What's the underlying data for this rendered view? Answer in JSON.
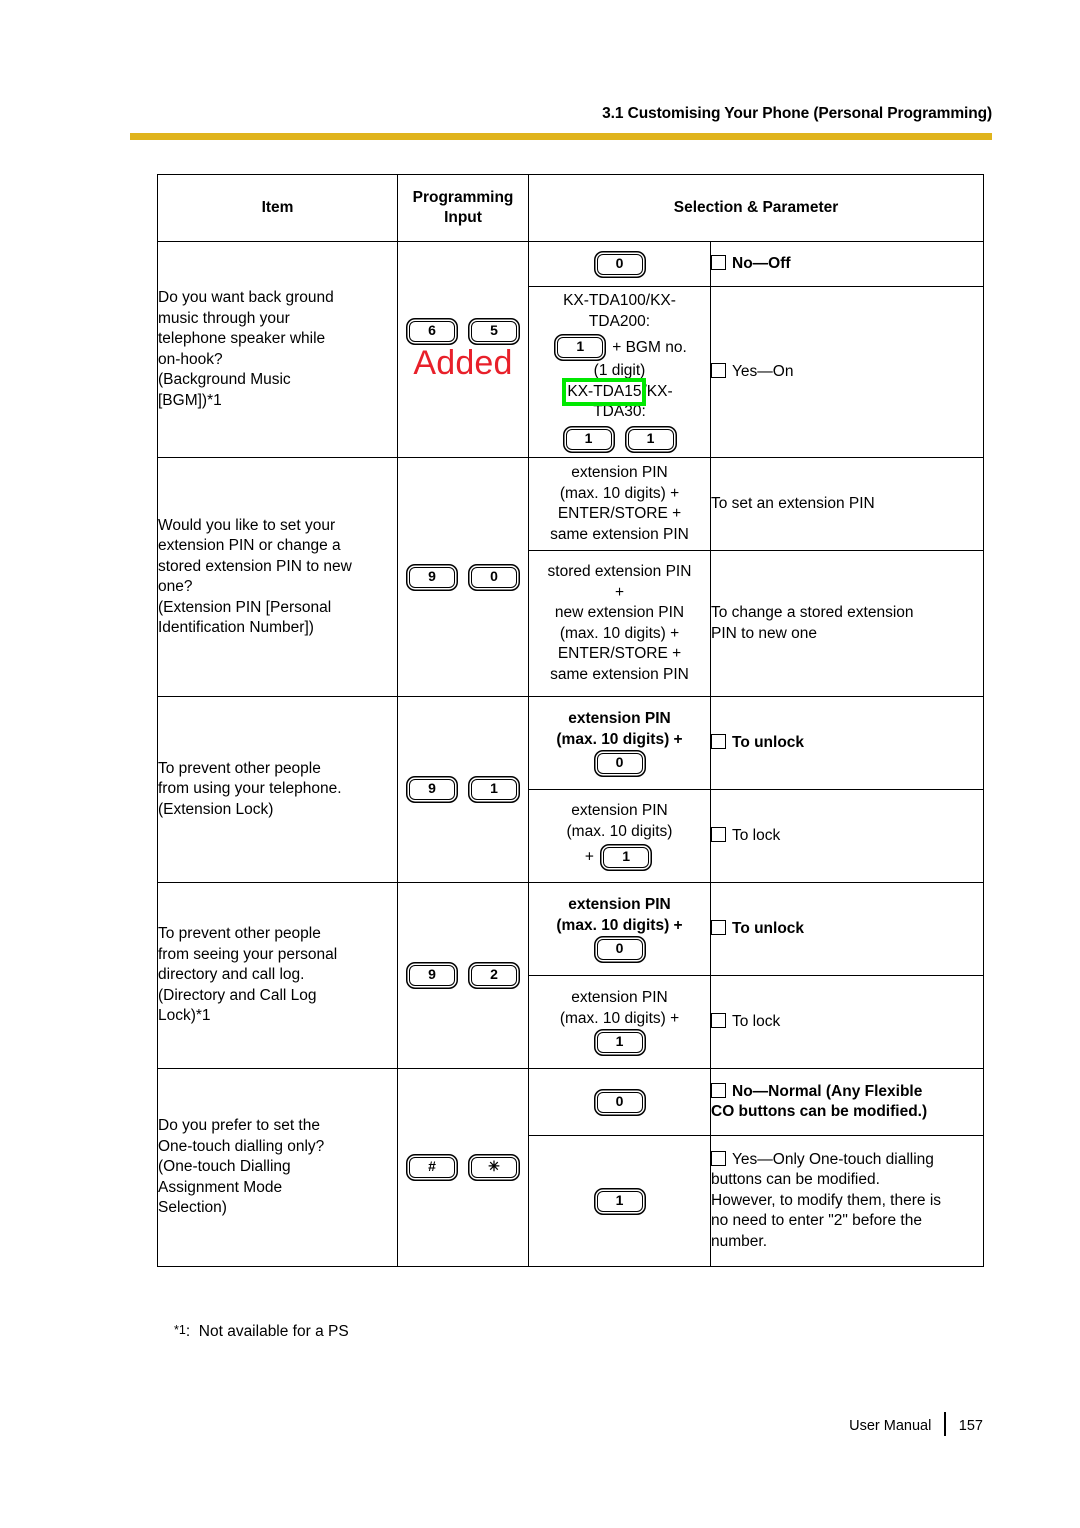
{
  "header": {
    "title": "3.1 Customising Your Phone (Personal Programming)",
    "rule_color": "#e0b41c"
  },
  "annotations": {
    "added_label": "Added",
    "added_color": "#e8202a",
    "highlight_color": "#00e800",
    "highlighted_text": "KX-TDA15"
  },
  "table": {
    "columns": [
      {
        "label": "Item"
      },
      {
        "label_line1": "Programming",
        "label_line2": "Input"
      },
      {
        "label": "Selection & Parameter"
      }
    ],
    "rows": [
      {
        "item": "Do you want back ground music through your telephone speaker while on-hook? (Background Music [BGM])*1",
        "item_lines": [
          "Do you want back ground",
          "music through your",
          "telephone speaker while",
          "on-hook?",
          "(Background Music",
          "[BGM])*1"
        ],
        "programming_input": [
          "6",
          "5"
        ],
        "options": [
          {
            "selection_lines": [],
            "selection_key": "0",
            "parameter": "No—Off",
            "parameter_bold": true
          },
          {
            "selection_lines": [
              "KX-TDA100/KX-",
              "TDA200:"
            ],
            "selection_key_inline": "1",
            "selection_inline_suffix": "+ BGM no.",
            "selection_sub": "(1 digit)",
            "selection_lines2_hl": "KX-TDA15",
            "selection_lines2_rest": "/KX-",
            "selection_lines3": "TDA30:",
            "selection_keys2": [
              "1",
              "1"
            ],
            "parameter": "Yes—On",
            "parameter_bold": false
          }
        ]
      },
      {
        "item_lines": [
          "Would you like to set your",
          "extension PIN or change a",
          "stored extension PIN to new",
          "one?",
          "(Extension PIN [Personal",
          "Identification Number])"
        ],
        "programming_input": [
          "9",
          "0"
        ],
        "options": [
          {
            "selection_text_lines": [
              "extension PIN",
              "(max. 10 digits) +",
              "ENTER/STORE +",
              "same extension PIN"
            ],
            "parameter_lines": [
              "To set an extension PIN"
            ],
            "parameter_bold": false
          },
          {
            "selection_text_lines": [
              "stored extension PIN",
              "+",
              "new extension PIN",
              "(max. 10 digits) +",
              "ENTER/STORE +",
              "same extension PIN"
            ],
            "parameter_lines": [
              "To change a stored extension",
              "PIN to new one"
            ],
            "parameter_bold": false
          }
        ]
      },
      {
        "item_lines": [
          "To prevent other people",
          "from using your telephone.",
          "(Extension Lock)"
        ],
        "programming_input": [
          "9",
          "1"
        ],
        "options": [
          {
            "selection_text_lines": [
              "extension PIN",
              "(max. 10 digits) +"
            ],
            "selection_bold": true,
            "selection_key": "0",
            "parameter": "To unlock",
            "parameter_bold": true
          },
          {
            "selection_text_lines": [
              "extension PIN",
              "(max. 10 digits)"
            ],
            "selection_bold": false,
            "selection_plus_key": "1",
            "parameter": "To lock",
            "parameter_bold": false
          }
        ]
      },
      {
        "item_lines": [
          "To prevent other people",
          "from seeing your personal",
          "directory and call log.",
          "(Directory and Call Log",
          "Lock)*1"
        ],
        "programming_input": [
          "9",
          "2"
        ],
        "options": [
          {
            "selection_text_lines": [
              "extension PIN",
              "(max. 10 digits) +"
            ],
            "selection_bold": true,
            "selection_key": "0",
            "parameter": "To unlock",
            "parameter_bold": true
          },
          {
            "selection_text_lines": [
              "extension PIN",
              "(max. 10 digits) +"
            ],
            "selection_bold": false,
            "selection_key": "1",
            "parameter": "To lock",
            "parameter_bold": false
          }
        ]
      },
      {
        "item_lines": [
          "Do you prefer to set the",
          "One-touch dialling only?",
          "(One-touch Dialling",
          "Assignment Mode",
          "Selection)"
        ],
        "programming_input": [
          "#",
          "✳"
        ],
        "options": [
          {
            "selection_key": "0",
            "parameter_lines": [
              "No—Normal (Any Flexible",
              "CO buttons can be modified.)"
            ],
            "parameter_bold": true
          },
          {
            "selection_key": "1",
            "parameter_lines": [
              "Yes—Only One-touch dialling",
              "buttons can be modified.",
              "However, to modify them, there is",
              "no need to enter \"2\" before the",
              "number."
            ],
            "parameter_bold": false
          }
        ]
      }
    ]
  },
  "footnote": {
    "mark": "*1",
    "separator": ":",
    "text": "Not available for a PS"
  },
  "footer": {
    "label": "User Manual",
    "page_number": "157"
  }
}
